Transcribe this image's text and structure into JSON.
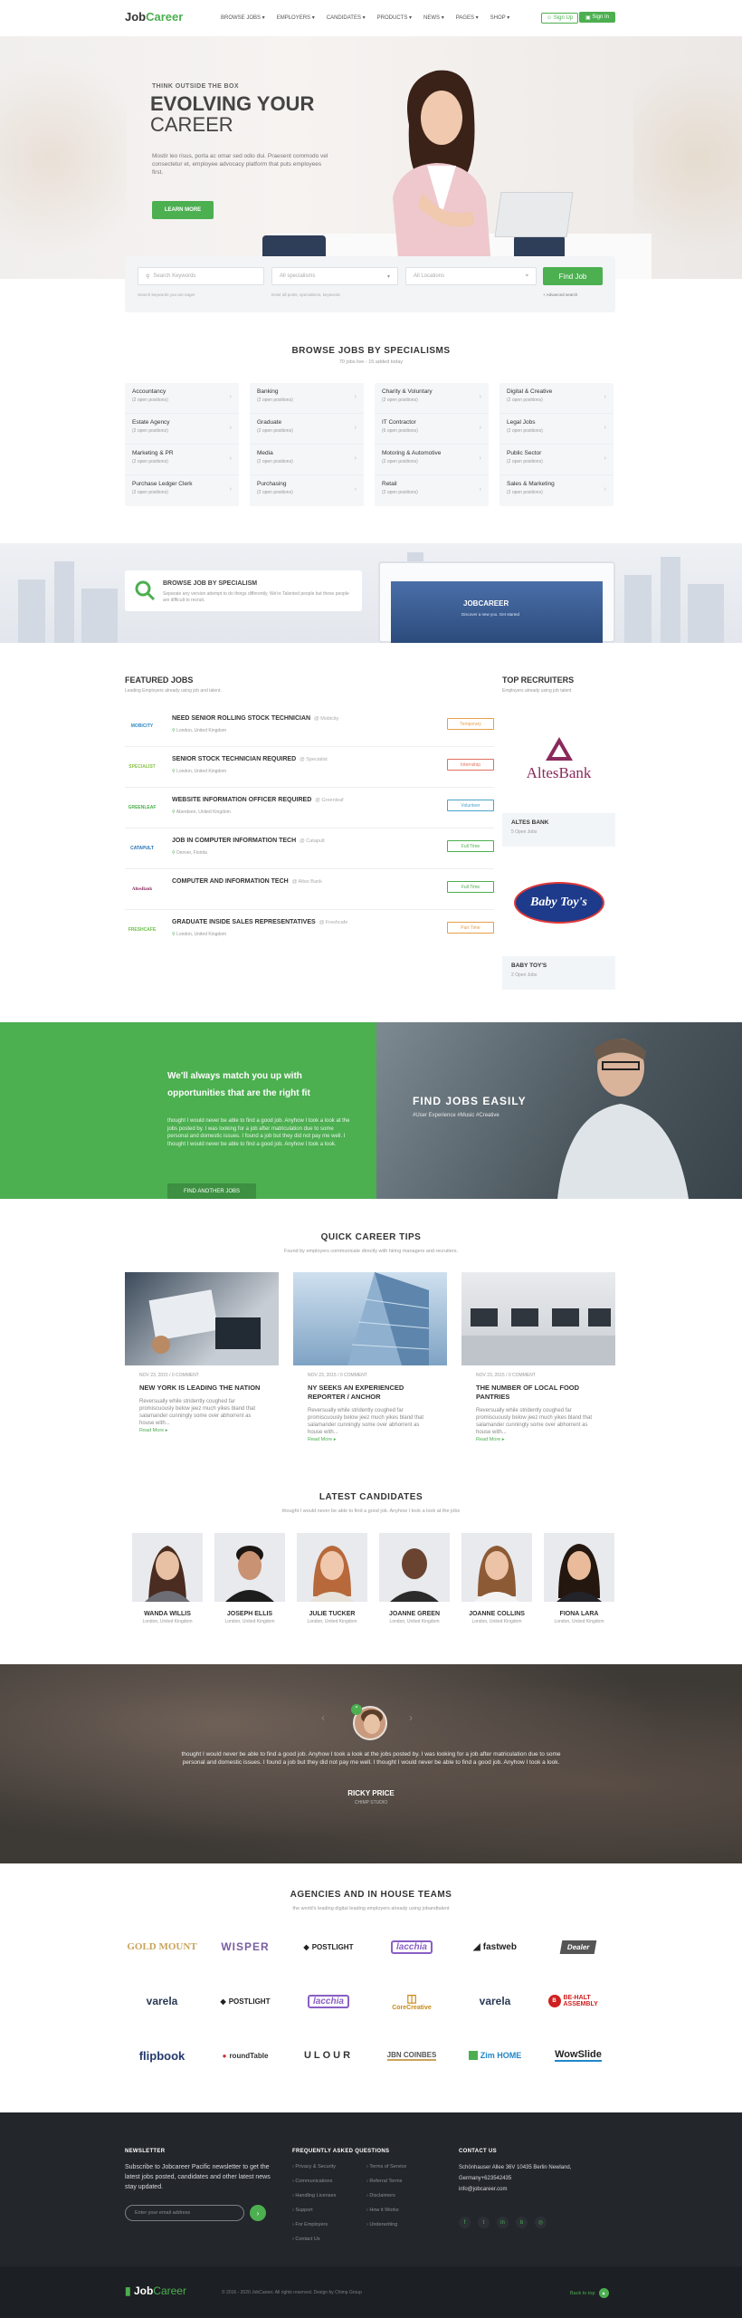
{
  "header": {
    "logo_job": "Job",
    "logo_career": "Career",
    "nav": [
      "BROWSE JOBS",
      "EMPLOYERS",
      "CANDIDATES",
      "PRODUCTS",
      "NEWS",
      "PAGES",
      "SHOP"
    ],
    "sign_up": "Sign Up",
    "sign_in": "Sign In"
  },
  "hero": {
    "kicker": "THINK OUTSIDE THE BOX",
    "title_line1": "EVOLVING YOUR",
    "title_line2": "CAREER",
    "text": "Mostir leo risus, porta ac omar sed odio dui. Praesent commodo vel consectetur et, employee advocacy platform that puts employees first.",
    "cta": "LEARN MORE"
  },
  "search": {
    "keywords_placeholder": "Search Keywords",
    "specialisms_placeholder": "All specialisms",
    "location_placeholder": "All Locations",
    "button": "Find Job",
    "hint_keywords": "Search keywords you are eager",
    "hint_specialisms": "Enter all posts, specialisms, keywords",
    "hint_location": "+ Advanced search"
  },
  "specialisms": {
    "title": "BROWSE JOBS BY SPECIALISMS",
    "subtitle": "70 jobs live - 15 added today",
    "columns": [
      [
        {
          "name": "Accountancy",
          "count": "(2 open positions)"
        },
        {
          "name": "Estate Agency",
          "count": "(2 open positions)"
        },
        {
          "name": "Marketing & PR",
          "count": "(2 open positions)"
        },
        {
          "name": "Purchase Ledger Clerk",
          "count": "(2 open positions)"
        }
      ],
      [
        {
          "name": "Banking",
          "count": "(2 open positions)"
        },
        {
          "name": "Graduate",
          "count": "(2 open positions)"
        },
        {
          "name": "Media",
          "count": "(2 open positions)"
        },
        {
          "name": "Purchasing",
          "count": "(2 open positions)"
        }
      ],
      [
        {
          "name": "Charity & Voluntary",
          "count": "(2 open positions)"
        },
        {
          "name": "IT Contractor",
          "count": "(6 open positions)"
        },
        {
          "name": "Motoring & Automotive",
          "count": "(2 open positions)"
        },
        {
          "name": "Retail",
          "count": "(2 open positions)"
        }
      ],
      [
        {
          "name": "Digital & Creative",
          "count": "(2 open positions)"
        },
        {
          "name": "Legal Jobs",
          "count": "(2 open positions)"
        },
        {
          "name": "Public Sector",
          "count": "(2 open positions)"
        },
        {
          "name": "Sales & Marketing",
          "count": "(2 open positions)"
        }
      ]
    ]
  },
  "banner": {
    "title": "BROWSE JOB BY SPECIALISM",
    "text": "Separate any version attempt to do things differently. We're Talented people but these people are difficult to recruit.",
    "screen_logo": "JOBCAREER",
    "screen_caption": "Discover a new you. Get started"
  },
  "featured": {
    "title": "FEATURED JOBS",
    "subtitle": "Leading Employers already using job and talent.",
    "jobs": [
      {
        "logo": "MOBICITY",
        "title": "NEED SENIOR ROLLING STOCK TECHNICIAN",
        "company": "@ Mobicity",
        "location": "London, United Kingdom",
        "type": "Temporary",
        "color": "#e6a04a"
      },
      {
        "logo": "SPECIALIST",
        "title": "SENIOR STOCK TECHNICIAN REQUIRED",
        "company": "@ Specialist",
        "location": "London, United Kingdom",
        "type": "Internship",
        "color": "#e07060"
      },
      {
        "logo": "GREENLEAF",
        "title": "WEBSITE INFORMATION OFFICER REQUIRED",
        "company": "@ Greenleaf",
        "location": "Aberdeen, United Kingdom",
        "type": "Volunteer",
        "color": "#4aa3c9"
      },
      {
        "logo": "CATAPULT",
        "title": "JOB IN COMPUTER INFORMATION TECH",
        "company": "@ Catapult",
        "location": "Denver, Florida",
        "type": "Full Time",
        "color": "#4caf50"
      },
      {
        "logo": "AltesBank",
        "title": "COMPUTER AND INFORMATION TECH",
        "company": "@ Altes Bank",
        "location": "",
        "type": "Full Time",
        "color": "#4caf50"
      },
      {
        "logo": "FRESHCAFE",
        "title": "GRADUATE INSIDE SALES REPRESENTATIVES",
        "company": "@ Freshcafe",
        "location": "London, United Kingdom",
        "type": "Part Time",
        "color": "#e6a04a"
      }
    ]
  },
  "recruiters": {
    "title": "TOP RECRUITERS",
    "subtitle": "Employers already using job talent",
    "items": [
      {
        "logo": "AltesBank",
        "name": "ALTES BANK",
        "jobs": "5 Open Jobs"
      },
      {
        "logo": "Baby Toy's",
        "name": "BABY TOY'S",
        "jobs": "2 Open Jobs"
      }
    ]
  },
  "match": {
    "title_line1": "We'll always match you up with",
    "title_line2": "opportunities that are the right fit",
    "text": "thought I would never be able to find a good job. Anyhow I took a look at the jobs posted by. I was looking for a job after matriculation due to some personal and domestic issues. I found a job but they did not pay me well. I thought I would never be able to find a good job. Anyhow I took a look.",
    "button": "FIND ANOTHER JOBS",
    "image_title": "FIND JOBS EASILY",
    "image_tags": "#User Experience  #Music  #Creative"
  },
  "tips": {
    "title": "QUICK CAREER TIPS",
    "subtitle": "Found by employers communicate directly with hiring managers and recruiters.",
    "items": [
      {
        "meta": "NOV 23, 2015  /  0 COMMENT",
        "title": "NEW YORK IS LEADING THE NATION",
        "text": "Reversually while stridently coughed far promiscuously below jeez much yikes bland that salamander cunningly some over abhorrent as house with...",
        "more": "Read More"
      },
      {
        "meta": "NOV 23, 2015  /  0 COMMENT",
        "title": "NY SEEKS AN EXPERIENCED REPORTER / ANCHOR",
        "text": "Reversually while stridently coughed far promiscuously below jeez much yikes bland that salamander cunningly some over abhorrent as house with...",
        "more": "Read More"
      },
      {
        "meta": "NOV 23, 2015  /  0 COMMENT",
        "title": "THE NUMBER OF LOCAL FOOD PANTRIES",
        "text": "Reversually while stridently coughed far promiscuously below jeez much yikes bland that salamander cunningly some over abhorrent as house with...",
        "more": "Read More"
      }
    ]
  },
  "candidates": {
    "title": "LATEST CANDIDATES",
    "subtitle": "thought I would never be able to find a good job. Anyhow I took a look at the jobs",
    "items": [
      {
        "name": "WANDA WILLIS",
        "location": "London, United Kingdom"
      },
      {
        "name": "JOSEPH ELLIS",
        "location": "London, United Kingdom"
      },
      {
        "name": "JULIE TUCKER",
        "location": "London, United Kingdom"
      },
      {
        "name": "JOANNE GREEN",
        "location": "London, United Kingdom"
      },
      {
        "name": "JOANNE COLLINS",
        "location": "London, United Kingdom"
      },
      {
        "name": "FIONA LARA",
        "location": "London, United Kingdom"
      }
    ]
  },
  "testimonial": {
    "text": "thought I would never be able to find a good job. Anyhow I took a look at the jobs posted by. I was looking for a job after matriculation due to some personal and domestic issues. I found a job but they did not pay me well. I thought I would never be able to find a good job. Anyhow I took a look.",
    "name": "RICKY PRICE",
    "role": "CHIMP STUDIO"
  },
  "agencies": {
    "title": "AGENCIES AND IN HOUSE TEAMS",
    "subtitle": "the world's leading digital leading employers already using jobandtalent",
    "logos": [
      "GOLD MOUNT",
      "WISPER",
      "POSTLIGHT",
      "lacchia",
      "fastweb",
      "Dealer",
      "varela",
      "POSTLIGHT",
      "lacchia",
      "CoreCreative",
      "varela",
      "BE-HALT ASSEMBLY",
      "flipbook",
      "roundTable",
      "ULOUR",
      "JBN COINBES",
      "Zim HOME",
      "WowSlide"
    ]
  },
  "footer": {
    "newsletter_title": "NEWSLETTER",
    "newsletter_text": "Subscribe to Jobcareer Pacific newsletter to get the latest jobs posted, candidates and other latest news stay updated.",
    "email_placeholder": "Enter your email address",
    "faq_title": "FREQUENTLY ASKED QUESTIONS",
    "faq_col1": [
      "Privacy & Security",
      "Communications",
      "Handling Licenses",
      "Support",
      "For Employers",
      "Contact Us"
    ],
    "faq_col2": [
      "Terms of Service",
      "Referral Terms",
      "Disclaimers",
      "How it Works",
      "Underwriting"
    ],
    "contact_title": "CONTACT US",
    "contact_lines": [
      "Schönhauser Allee 36V 10435 Berlin Newland,",
      "Germany+623542435",
      "info@jobcareer.com"
    ],
    "copyright": "© 2016 - 2020 JobCareer. All rights reserved. Design by Chimp Group",
    "back_to_top": "Back to top",
    "logo_job": "Job",
    "logo_career": "Career"
  },
  "colors": {
    "accent": "#4caf50",
    "dark": "#23262b"
  }
}
